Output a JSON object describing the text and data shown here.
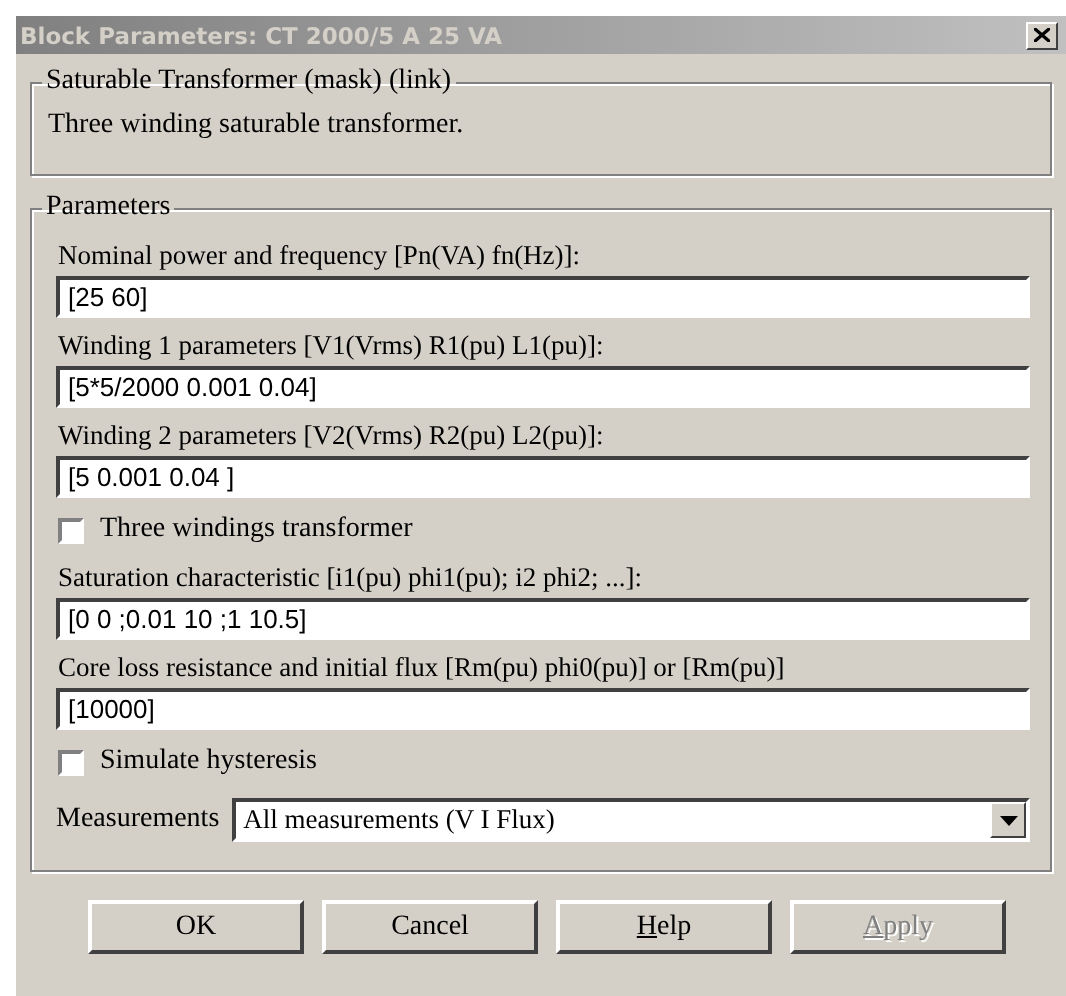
{
  "window": {
    "title": "Block Parameters: CT 2000/5 A 25 VA"
  },
  "description": {
    "title": "Saturable Transformer (mask) (link)",
    "text": "Three winding saturable transformer."
  },
  "parameters": {
    "title": "Parameters",
    "items": [
      {
        "kind": "field",
        "label": "Nominal power and frequency [Pn(VA) fn(Hz)]:",
        "value": "[25 60]"
      },
      {
        "kind": "field",
        "label": "Winding 1 parameters [V1(Vrms) R1(pu) L1(pu)]:",
        "value": "[5*5/2000 0.001 0.04]"
      },
      {
        "kind": "field",
        "label": "Winding 2 parameters [V2(Vrms) R2(pu) L2(pu)]:",
        "value": "[5 0.001 0.04 ]"
      },
      {
        "kind": "checkbox",
        "label": "Three windings transformer",
        "checked": false
      },
      {
        "kind": "field",
        "label": "Saturation characteristic [i1(pu) phi1(pu); i2 phi2; ...]:",
        "value": "[0 0 ;0.01 10 ;1 10.5]"
      },
      {
        "kind": "field",
        "label": "Core loss resistance and initial flux [Rm(pu) phi0(pu)] or [Rm(pu)]",
        "value": "[10000]"
      },
      {
        "kind": "checkbox",
        "label": "Simulate hysteresis",
        "checked": false
      },
      {
        "kind": "dropdown",
        "label": "Measurements",
        "value": "All measurements (V I Flux)"
      }
    ]
  },
  "buttons": [
    {
      "label": "OK",
      "disabled": false,
      "underline_first": false
    },
    {
      "label": "Cancel",
      "disabled": false,
      "underline_first": false
    },
    {
      "label": "Help",
      "disabled": false,
      "underline_first": true
    },
    {
      "label": "Apply",
      "disabled": true,
      "underline_first": true
    }
  ]
}
